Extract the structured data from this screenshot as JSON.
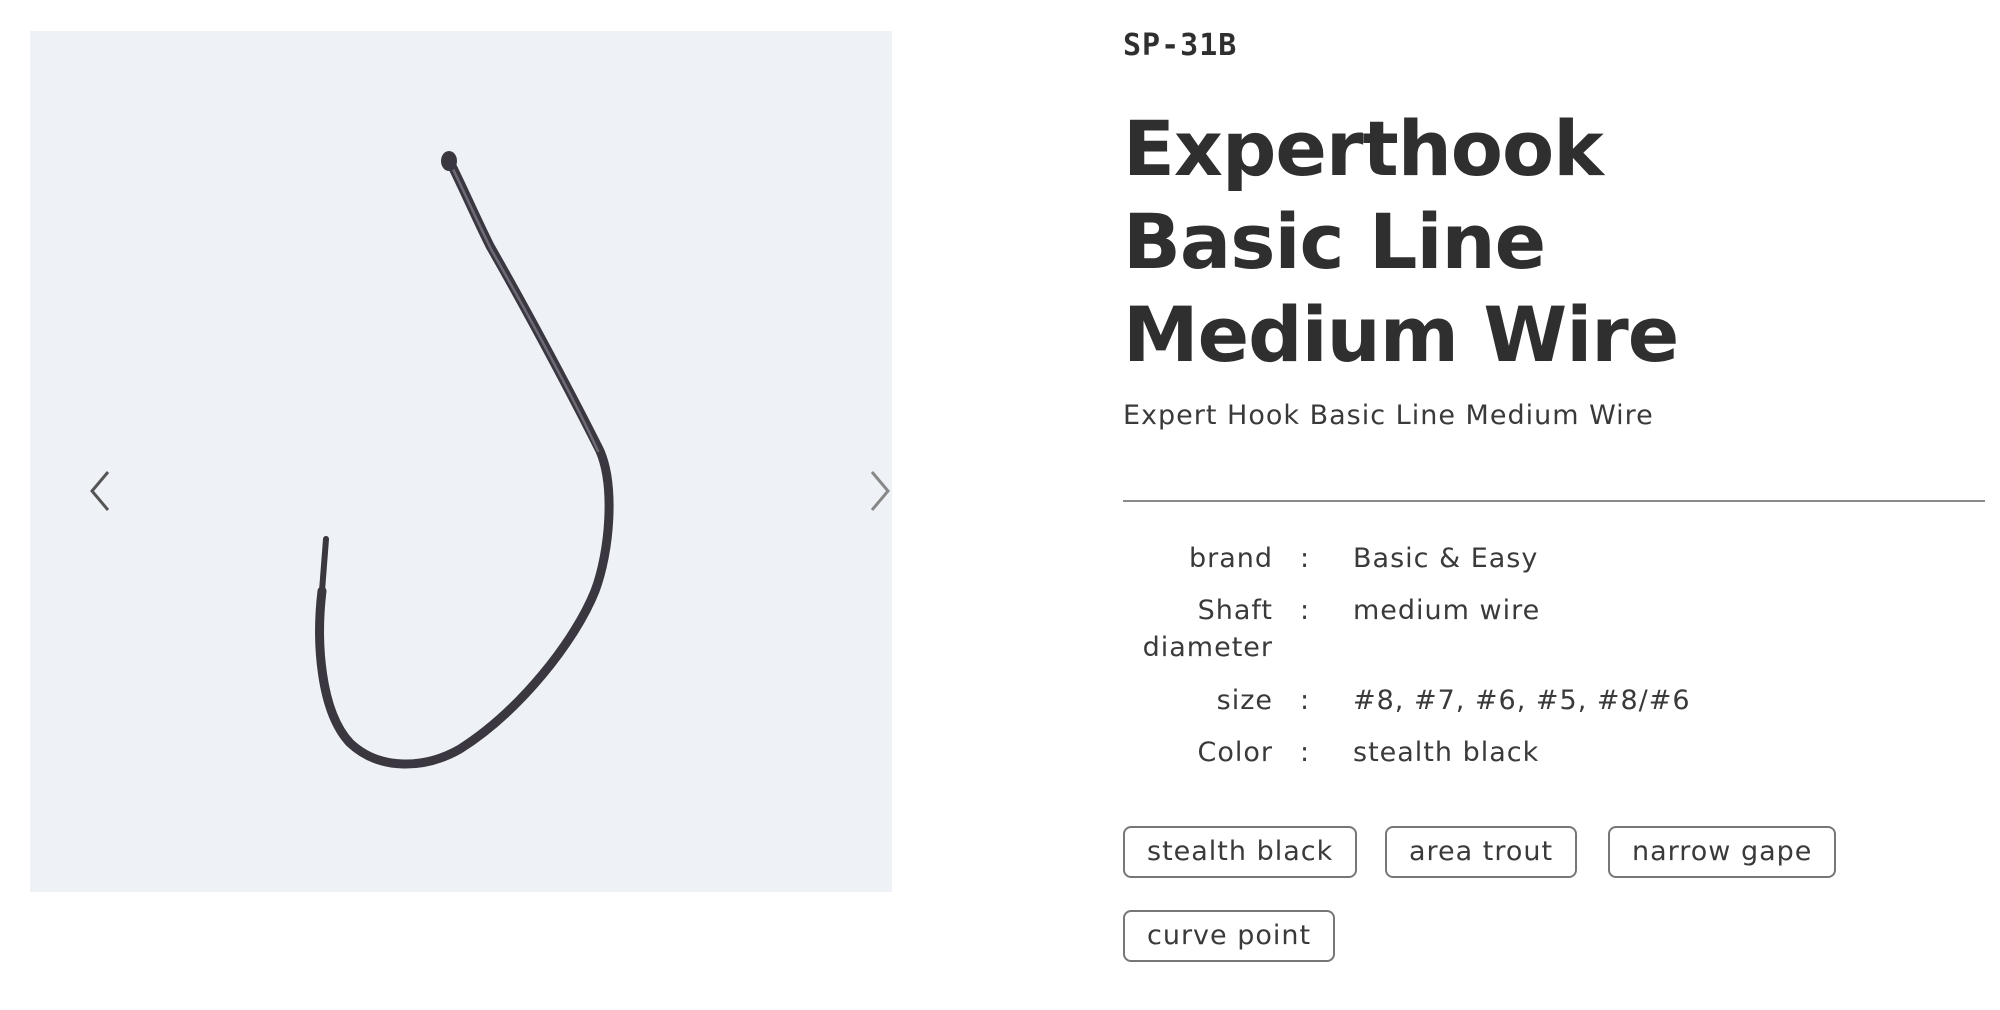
{
  "gallery": {
    "background_color": "#eef2f7",
    "image_icon": "fishing-hook-icon",
    "prev_icon": "chevron-left-icon",
    "next_icon": "chevron-right-icon"
  },
  "product": {
    "code": "SP-31B",
    "title_lines": [
      "Experthook",
      "Basic Line",
      "Medium Wire"
    ],
    "subtitle": "Expert Hook Basic Line Medium Wire",
    "specs": [
      {
        "label": "brand",
        "label_line2": "",
        "colon": ":",
        "value": "Basic & Easy"
      },
      {
        "label": "Shaft",
        "label_line2": "diameter",
        "colon": ":",
        "value": "medium wire"
      },
      {
        "label": "size",
        "label_line2": "",
        "colon": ":",
        "value": "#8, #7, #6, #5, #8/#6"
      },
      {
        "label": "Color",
        "label_line2": "",
        "colon": ":",
        "value": "stealth black"
      }
    ],
    "tags": [
      "stealth black",
      "area trout",
      "narrow gape",
      "curve point"
    ]
  },
  "colors": {
    "text": "#333333",
    "hook": "#3a3740",
    "divider": "#8a8a8a",
    "tag_border": "#777777"
  }
}
